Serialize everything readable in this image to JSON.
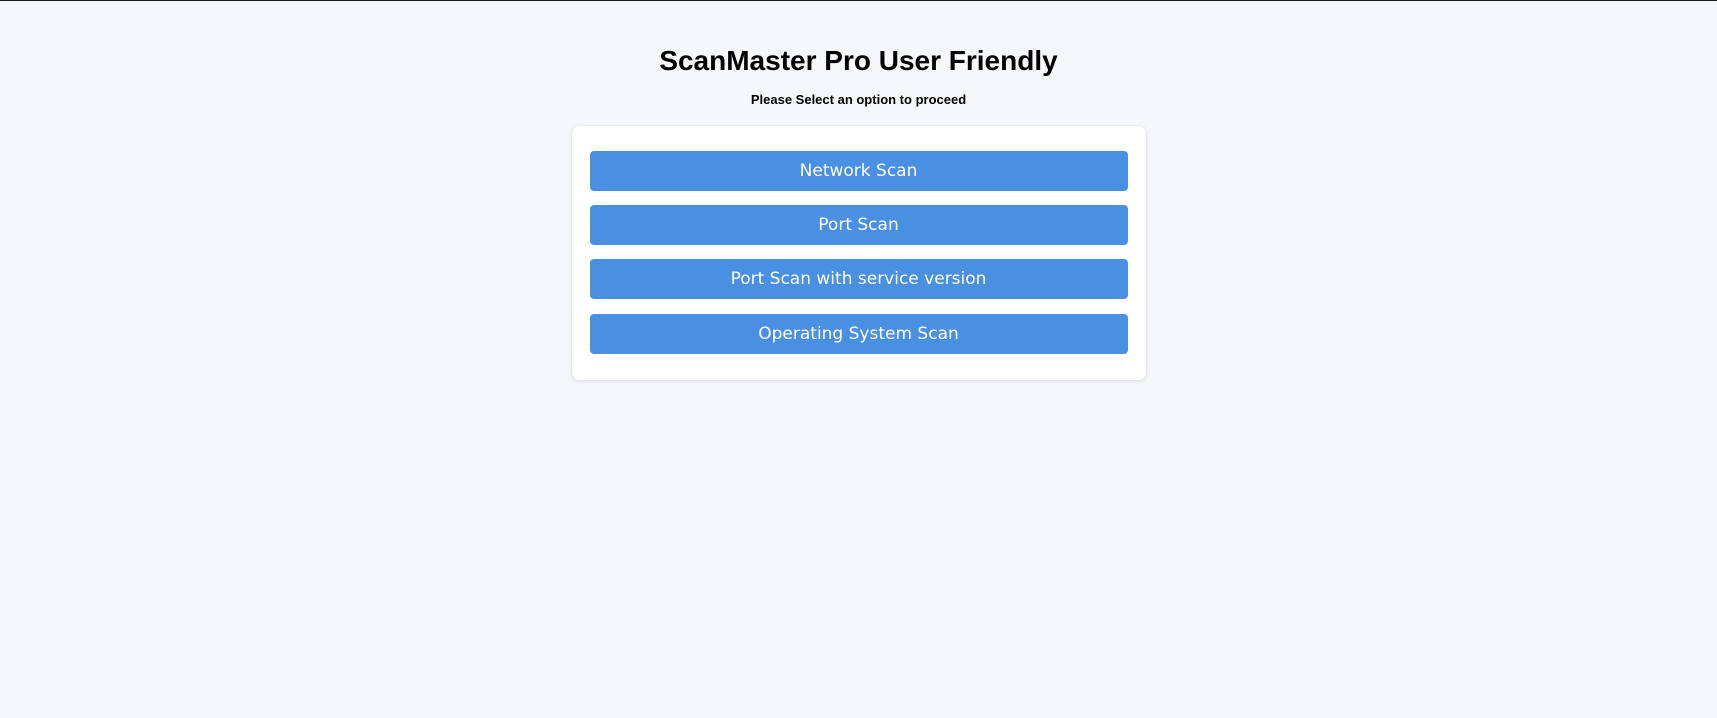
{
  "header": {
    "title": "ScanMaster Pro User Friendly",
    "subtitle": "Please Select an option to proceed"
  },
  "options": [
    {
      "label": "Network Scan"
    },
    {
      "label": "Port Scan"
    },
    {
      "label": "Port Scan with service version"
    },
    {
      "label": "Operating System Scan"
    }
  ],
  "colors": {
    "background": "#f5f7fa",
    "card": "#ffffff",
    "button": "#4a90e2",
    "button_text": "#ffffff"
  }
}
